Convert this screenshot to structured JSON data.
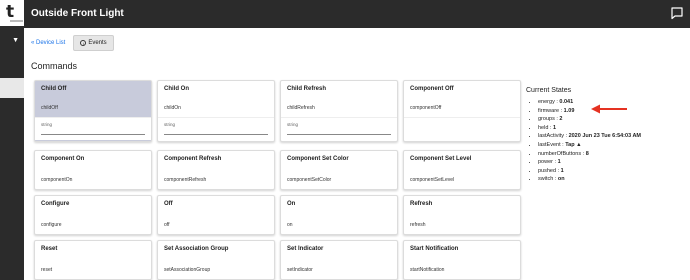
{
  "app": {
    "logo_text": "t",
    "page_title": "Outside Front Light"
  },
  "nav": {
    "device_list_label": "« Device List",
    "events_label": "Events",
    "events_icon": "info-icon"
  },
  "commands": {
    "section_title": "Commands",
    "cards": [
      {
        "title": "Child Off",
        "method": "childOff",
        "param_type": "string",
        "active": true
      },
      {
        "title": "Child On",
        "method": "childOn",
        "param_type": "string",
        "active": false
      },
      {
        "title": "Child Refresh",
        "method": "childRefresh",
        "param_type": "string",
        "active": false
      },
      {
        "title": "Component Off",
        "method": "componentOff",
        "param_type": "",
        "active": false
      },
      {
        "title": "Component On",
        "method": "componentOn",
        "active": false
      },
      {
        "title": "Component Refresh",
        "method": "componentRefresh",
        "active": false
      },
      {
        "title": "Component Set Color",
        "method": "componentSetColor",
        "active": false
      },
      {
        "title": "Component Set Level",
        "method": "componentSetLevel",
        "active": false
      },
      {
        "title": "Configure",
        "method": "configure",
        "active": false
      },
      {
        "title": "Off",
        "method": "off",
        "active": false
      },
      {
        "title": "On",
        "method": "on",
        "active": false
      },
      {
        "title": "Refresh",
        "method": "refresh",
        "active": false
      },
      {
        "title": "Reset",
        "method": "reset",
        "active": false
      },
      {
        "title": "Set Association Group",
        "method": "setAssociationGroup",
        "active": false
      },
      {
        "title": "Set Indicator",
        "method": "setIndicator",
        "active": false
      },
      {
        "title": "Start Notification",
        "method": "startNotification",
        "active": false
      }
    ]
  },
  "current_states": {
    "title": "Current States",
    "items": [
      {
        "name": "energy : ",
        "value": "0.041"
      },
      {
        "name": "firmware : ",
        "value": "1.09"
      },
      {
        "name": "groups : ",
        "value": "2"
      },
      {
        "name": "held : ",
        "value": "1"
      },
      {
        "name": "lastActivity : ",
        "value": "2020 Jun 23 Tue 6:54:03 AM"
      },
      {
        "name": "lastEvent : ",
        "value": "Tap ▲"
      },
      {
        "name": "numberOfButtons : ",
        "value": "8"
      },
      {
        "name": "power : ",
        "value": "1"
      },
      {
        "name": "pushed : ",
        "value": "1"
      },
      {
        "name": "switch : ",
        "value": "on"
      }
    ]
  },
  "colors": {
    "topbar": "#2b2b2b",
    "link": "#1a73e8",
    "active_card": "#c8cbdb",
    "annotation_arrow": "#e53222"
  }
}
